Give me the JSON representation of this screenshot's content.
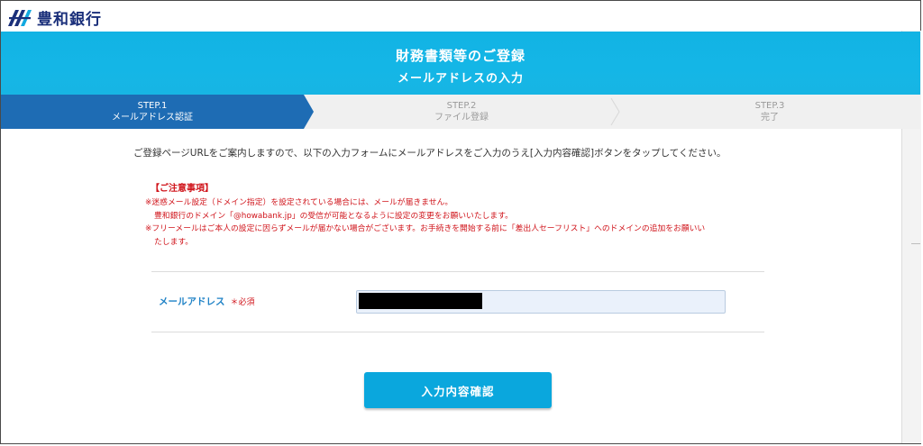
{
  "header": {
    "bank_name": "豊和銀行"
  },
  "banner": {
    "title": "財務書類等のご登録",
    "subtitle": "メールアドレスの入力"
  },
  "steps": [
    {
      "number": "STEP.1",
      "label": "メールアドレス認証",
      "state": "active"
    },
    {
      "number": "STEP.2",
      "label": "ファイル登録",
      "state": "inactive"
    },
    {
      "number": "STEP.3",
      "label": "完了",
      "state": "inactive"
    }
  ],
  "intro": "ご登録ページURLをご案内しますので、以下の入力フォームにメールアドレスをご入力のうえ[入力内容確認]ボタンをタップしてください。",
  "notice": {
    "title": "【ご注意事項】",
    "lines": [
      "※迷惑メール設定（ドメイン指定）を設定されている場合には、メールが届きません。",
      "豊和銀行のドメイン「@howabank.jp」の受信が可能となるように設定の変更をお願いいたします。",
      "※フリーメールはご本人の設定に因らずメールが届かない場合がございます。お手続きを開始する前に「差出人セーフリスト」へのドメインの追加をお願いい",
      "たします。"
    ]
  },
  "form": {
    "email_label": "メールアドレス",
    "required_mark": "＊必須",
    "email_value": ""
  },
  "confirm_button_label": "入力内容確認",
  "colors": {
    "banner": "#14b6e6",
    "active_step": "#1e6cb4",
    "notice_red": "#d0141b",
    "label_blue": "#1f82c6",
    "button": "#0aa7dd"
  }
}
